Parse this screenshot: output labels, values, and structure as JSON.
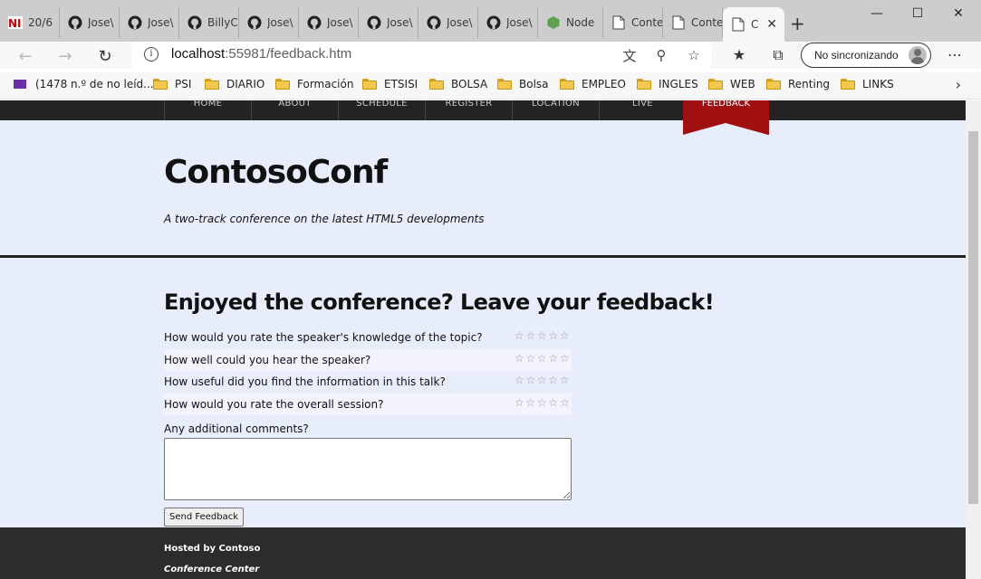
{
  "browser": {
    "tabs": [
      {
        "label": "20/6",
        "icon": "news-icon",
        "active": false
      },
      {
        "label": "Jose\\",
        "icon": "github-icon",
        "active": false
      },
      {
        "label": "Jose\\",
        "icon": "github-icon",
        "active": false
      },
      {
        "label": "BillyC",
        "icon": "github-icon",
        "active": false
      },
      {
        "label": "Jose\\",
        "icon": "github-icon",
        "active": false
      },
      {
        "label": "Jose\\",
        "icon": "github-icon",
        "active": false
      },
      {
        "label": "Jose\\",
        "icon": "github-icon",
        "active": false
      },
      {
        "label": "Jose\\",
        "icon": "github-icon",
        "active": false
      },
      {
        "label": "Jose\\",
        "icon": "github-icon",
        "active": false
      },
      {
        "label": "Node",
        "icon": "node-icon",
        "active": false
      },
      {
        "label": "Conte",
        "icon": "page-icon",
        "active": false
      },
      {
        "label": "Conte",
        "icon": "page-icon",
        "active": false
      },
      {
        "label": "C",
        "icon": "page-icon",
        "active": true
      }
    ],
    "address": {
      "host": "localhost",
      "rest": ":55981/feedback.htm"
    },
    "sync_label": "No sincronizando",
    "bookmarks": [
      {
        "label": "(1478 n.º de no leíd...",
        "icon": "mail-icon"
      },
      {
        "label": "PSI",
        "icon": "folder-icon"
      },
      {
        "label": "DIARIO",
        "icon": "folder-icon"
      },
      {
        "label": "Formación",
        "icon": "folder-icon"
      },
      {
        "label": "ETSISI",
        "icon": "folder-icon"
      },
      {
        "label": "BOLSA",
        "icon": "folder-icon"
      },
      {
        "label": "Bolsa",
        "icon": "folder-icon"
      },
      {
        "label": "EMPLEO",
        "icon": "folder-icon"
      },
      {
        "label": "INGLES",
        "icon": "folder-icon"
      },
      {
        "label": "WEB",
        "icon": "folder-icon"
      },
      {
        "label": "Renting",
        "icon": "folder-icon"
      },
      {
        "label": "LINKS",
        "icon": "folder-icon"
      }
    ]
  },
  "site": {
    "nav": [
      {
        "label": "HOME"
      },
      {
        "label": "ABOUT"
      },
      {
        "label": "SCHEDULE"
      },
      {
        "label": "REGISTER"
      },
      {
        "label": "LOCATION"
      },
      {
        "label": "LIVE"
      }
    ],
    "nav_active": "FEEDBACK",
    "brand": "ContosoConf",
    "tagline": "A two-track conference on the latest HTML5 developments",
    "heading": "Enjoyed the conference? Leave your feedback!",
    "questions": [
      {
        "text": "How would you rate the speaker's knowledge of the topic?",
        "rating": 0
      },
      {
        "text": "How well could you hear the speaker?",
        "rating": 0
      },
      {
        "text": "How useful did you find the information in this talk?",
        "rating": 0
      },
      {
        "text": "How would you rate the overall session?",
        "rating": 0
      }
    ],
    "max_rating": 5,
    "comments_label": "Any additional comments?",
    "comments_value": "",
    "send_label": "Send Feedback",
    "footer": {
      "hosted": "Hosted by Contoso",
      "venue": "Conference Center"
    }
  },
  "colors": {
    "page_bg": "#e8edfb",
    "nav_bg": "#232323",
    "ribbon": "#a01010",
    "footer_bg": "#2c2c2c"
  }
}
